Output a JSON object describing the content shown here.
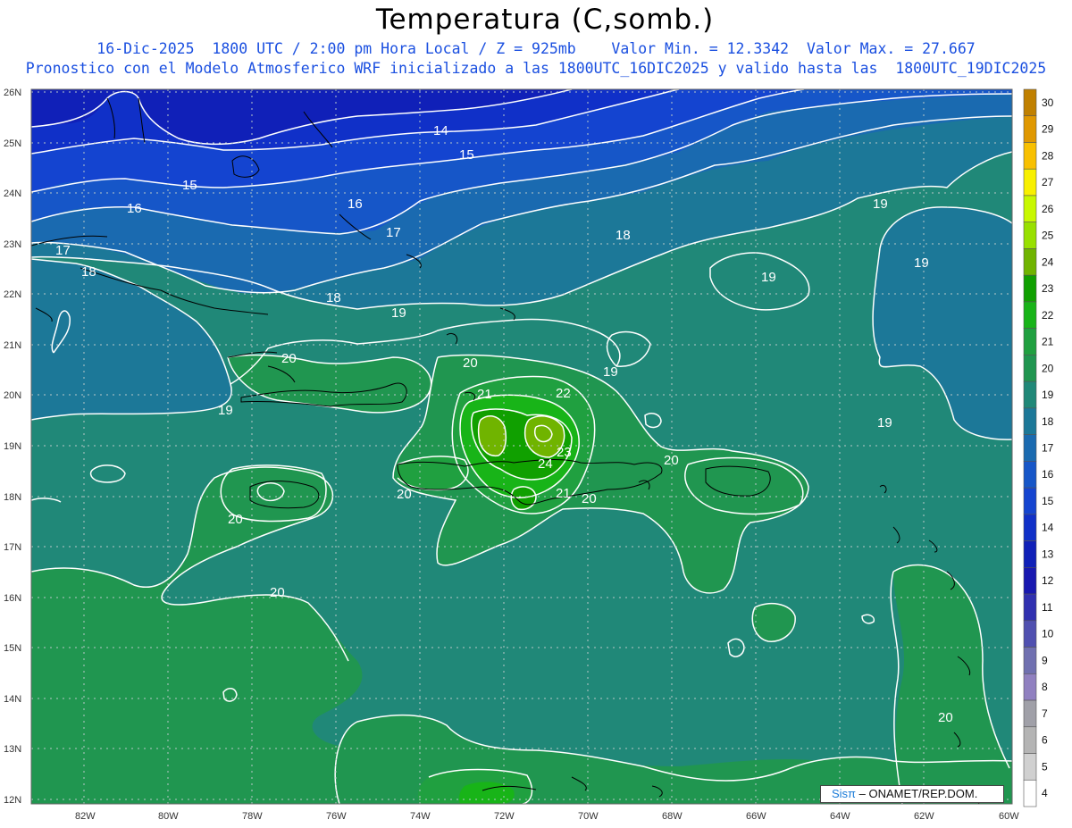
{
  "title": "Temperatura (C,somb.)",
  "subtitle_line1": "16-Dic-2025  1800 UTC / 2:00 pm Hora Local / Z = 925mb    Valor Min. = 12.3342  Valor Max. = 27.667",
  "subtitle_line2": "Pronostico con el Modelo Atmosferico WRF inicializado a las 1800UTC_16DIC2025 y valido hasta las  1800UTC_19DIC2025",
  "credit": {
    "brand": "Sisπ",
    "text": "– ONAMET/REP.DOM."
  },
  "lat_labels": [
    "26N",
    "25N",
    "24N",
    "23N",
    "22N",
    "21N",
    "20N",
    "19N",
    "18N",
    "17N",
    "16N",
    "15N",
    "14N",
    "13N",
    "12N"
  ],
  "lon_labels": [
    "82W",
    "80W",
    "78W",
    "76W",
    "74W",
    "72W",
    "70W",
    "68W",
    "66W",
    "64W",
    "62W",
    "60W"
  ],
  "colorbar": {
    "levels": [
      "30",
      "29",
      "28",
      "27",
      "26",
      "25",
      "24",
      "23",
      "22",
      "21",
      "20",
      "19",
      "18",
      "17",
      "16",
      "15",
      "14",
      "13",
      "12",
      "11",
      "10",
      "9",
      "8",
      "7",
      "6",
      "5",
      "4"
    ],
    "colors": [
      "#c08000",
      "#e09800",
      "#f8c000",
      "#f8f000",
      "#c8f800",
      "#98e000",
      "#70b400",
      "#10a000",
      "#18b418",
      "#20a040",
      "#209650",
      "#208878",
      "#1c7898",
      "#1a6ab0",
      "#1656c8",
      "#1444d0",
      "#1030c8",
      "#1020b8",
      "#1818b0",
      "#3030b0",
      "#5050b0",
      "#7070b0",
      "#9080c0",
      "#a0a0a8",
      "#b4b4b4",
      "#d0d0d0",
      "#ffffff"
    ]
  },
  "contour_labels": [
    {
      "text": "14"
    },
    {
      "text": "15"
    },
    {
      "text": "15"
    },
    {
      "text": "16"
    },
    {
      "text": "16"
    },
    {
      "text": "17"
    },
    {
      "text": "17"
    },
    {
      "text": "18"
    },
    {
      "text": "18"
    },
    {
      "text": "18"
    },
    {
      "text": "19"
    },
    {
      "text": "19"
    },
    {
      "text": "19"
    },
    {
      "text": "19"
    },
    {
      "text": "19"
    },
    {
      "text": "19"
    },
    {
      "text": "19"
    },
    {
      "text": "20"
    },
    {
      "text": "20"
    },
    {
      "text": "20"
    },
    {
      "text": "20"
    },
    {
      "text": "20"
    },
    {
      "text": "20"
    },
    {
      "text": "20"
    },
    {
      "text": "20"
    },
    {
      "text": "21"
    },
    {
      "text": "21"
    },
    {
      "text": "22"
    },
    {
      "text": "23"
    },
    {
      "text": "24"
    }
  ]
}
